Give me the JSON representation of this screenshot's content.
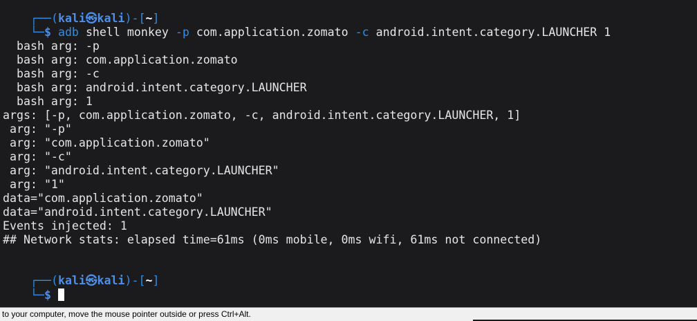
{
  "prompt1": {
    "corner_top": "┌──",
    "open": "(",
    "user": "kali",
    "at": "㉿",
    "host": "kali",
    "close": ")-[",
    "cwd": "~",
    "end": "]",
    "corner_bottom": "└─",
    "dollar": "$"
  },
  "command": {
    "program": "adb",
    "args1": "shell monkey",
    "flag_p": "-p",
    "package": "com.application.zomato",
    "flag_c": "-c",
    "tail": "android.intent.category.LAUNCHER 1"
  },
  "output": [
    "",
    "  bash arg: -p",
    "  bash arg: com.application.zomato",
    "  bash arg: -c",
    "  bash arg: android.intent.category.LAUNCHER",
    "  bash arg: 1",
    "args: [-p, com.application.zomato, -c, android.intent.category.LAUNCHER, 1]",
    " arg: \"-p\"",
    " arg: \"com.application.zomato\"",
    " arg: \"-c\"",
    " arg: \"android.intent.category.LAUNCHER\"",
    " arg: \"1\"",
    "data=\"com.application.zomato\"",
    "data=\"android.intent.category.LAUNCHER\"",
    "Events injected: 1",
    "## Network stats: elapsed time=61ms (0ms mobile, 0ms wifi, 61ms not connected)"
  ],
  "prompt2": {
    "corner_top": "┌──",
    "open": "(",
    "user": "kali",
    "at": "㉿",
    "host": "kali",
    "close": ")-[",
    "cwd": "~",
    "end": "]",
    "corner_bottom": "└─",
    "dollar": "$"
  },
  "statusbar": {
    "text": "to your computer, move the mouse pointer outside or press Ctrl+Alt."
  }
}
